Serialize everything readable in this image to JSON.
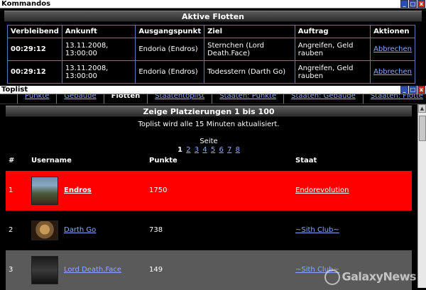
{
  "kommandos": {
    "title": "Kommandos",
    "section_title": "Aktive Flotten",
    "columns": [
      "Verbleibend",
      "Ankunft",
      "Ausgangspunkt",
      "Ziel",
      "Auftrag",
      "Aktionen"
    ],
    "rows": [
      {
        "remaining": "00:29:12",
        "arrival": "13.11.2008, 13:00:00",
        "origin": "Endoria (Endros)",
        "target": "Sternchen (Lord Death.Face)",
        "order": "Angreifen, Geld rauben",
        "action": "Abbrechen"
      },
      {
        "remaining": "00:29:12",
        "arrival": "13.11.2008, 13:00:00",
        "origin": "Endoria (Endros)",
        "target": "Todesstern (Darth Go)",
        "order": "Angreifen, Geld rauben",
        "action": "Abbrechen"
      }
    ]
  },
  "toplist": {
    "title": "Toplist",
    "tabs": [
      {
        "label": "Punkte",
        "active": false
      },
      {
        "label": "Gebäude",
        "active": false
      },
      {
        "label": "Flotten",
        "active": true
      },
      {
        "label": "Staatentoplist",
        "active": false
      },
      {
        "label": "Staaten: Punkte",
        "active": false
      },
      {
        "label": "Staaten: Gebäude",
        "active": false
      },
      {
        "label": "Staaten: Flotte",
        "active": false
      }
    ],
    "section_title": "Zeige Platzierungen 1 bis 100",
    "info": "Toplist wird alle 15 Minuten aktualisiert.",
    "page_label": "Seite",
    "current_page": "1",
    "pages": [
      "2",
      "3",
      "4",
      "5",
      "6",
      "7",
      "8"
    ],
    "headers": {
      "rank": "#",
      "user": "Username",
      "points": "Punkte",
      "state": "Staat"
    },
    "entries": [
      {
        "rank": "1",
        "user": "Endros",
        "points": "1750",
        "state": "Endorevolution"
      },
      {
        "rank": "2",
        "user": "Darth Go",
        "points": "738",
        "state": "~Sith Club~"
      },
      {
        "rank": "3",
        "user": "Lord Death.Face",
        "points": "149",
        "state": "~Sith Club~"
      }
    ]
  },
  "watermark": "GalaxyNews",
  "window_buttons": {
    "minimize": "_",
    "maximize": "□",
    "close": "x"
  },
  "colors": {
    "highlight_row": "#ff0000",
    "link": "#8fa8ff",
    "table_border": "#5a78c0"
  }
}
